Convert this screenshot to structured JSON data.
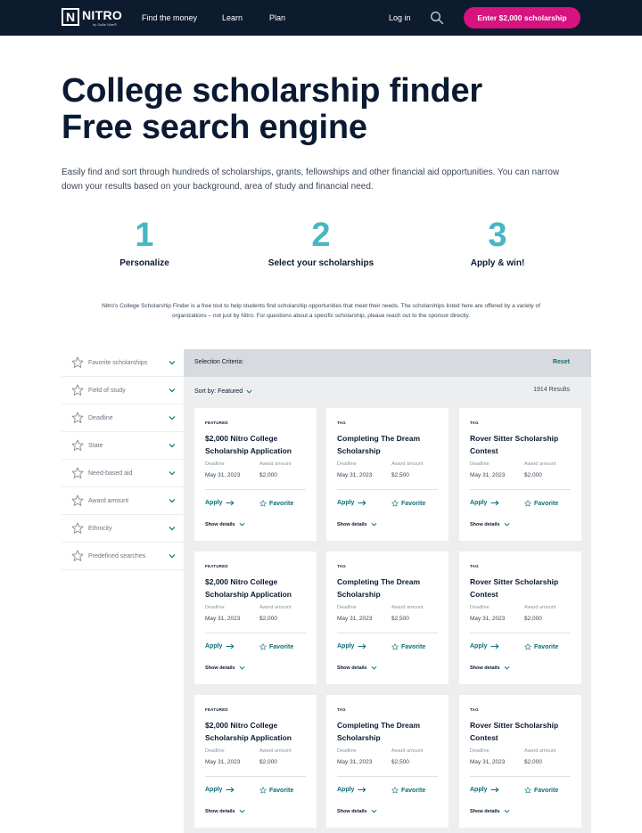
{
  "nav": {
    "logo_letter": "N",
    "logo_word": "NITRO",
    "logo_sub": "by Sallie Mae®",
    "links": [
      "Find the money",
      "Learn",
      "Plan"
    ],
    "login": "Log in",
    "search_icon": "search-icon",
    "cta": "Enter $2,000 scholarship",
    "cta_color": "#d6137f",
    "bg_color": "#0d1b2e"
  },
  "hero": {
    "title_line1": "College scholarship finder",
    "title_line2": "Free search engine",
    "description": "Easily find and sort through hundreds of scholarships, grants, fellowships and other financial aid opportunities. You can narrow down your results based on your background, area of study and financial need."
  },
  "steps": [
    {
      "number": "1",
      "label": "Personalize"
    },
    {
      "number": "2",
      "label": "Select your scholarships"
    },
    {
      "number": "3",
      "label": "Apply & win!"
    }
  ],
  "accent_color": "#46b7c4",
  "disclaimer": "Nitro’s College Scholarship Finder is a free tool to help students find scholarship opportunities that meet their needs. The scholarships listed here are offered by a variety of organizations – not just by Nitro. For questions about a specific scholarship, please reach out to the sponsor directly.",
  "filters": [
    "Favorite scholarships",
    "Field of study",
    "Deadline",
    "State",
    "Need-based aid",
    "Award amount",
    "Ethnicity",
    "Predefined searches"
  ],
  "panel": {
    "criteria_label": "Selection Criteria:",
    "reset": "Reset",
    "sort_label": "Sort by: Featured",
    "results": "1914 Results"
  },
  "card_labels": {
    "deadline": "Deadline",
    "award": "Award amount",
    "apply": "Apply",
    "favorite": "Favorite",
    "details": "Show details"
  },
  "cards": [
    {
      "tag": "FEATURED",
      "title": "$2,000 Nitro College Scholarship Application",
      "deadline": "May 31, 2023",
      "award": "$2,000"
    },
    {
      "tag": "TAG",
      "title": "Completing The Dream Scholarship",
      "deadline": "May 31, 2023",
      "award": "$2,500"
    },
    {
      "tag": "TAG",
      "title": "Rover Sitter Scholarship Contest",
      "deadline": "May 31, 2023",
      "award": "$2,000"
    },
    {
      "tag": "FEATURED",
      "title": "$2,000 Nitro College Scholarship Application",
      "deadline": "May 31, 2023",
      "award": "$2,000"
    },
    {
      "tag": "TAG",
      "title": "Completing The Dream Scholarship",
      "deadline": "May 31, 2023",
      "award": "$2,500"
    },
    {
      "tag": "TAG",
      "title": "Rover Sitter Scholarship Contest",
      "deadline": "May 31, 2023",
      "award": "$2,000"
    },
    {
      "tag": "FEATURED",
      "title": "$2,000 Nitro College Scholarship Application",
      "deadline": "May 31, 2023",
      "award": "$2,000"
    },
    {
      "tag": "TAG",
      "title": "Completing The Dream Scholarship",
      "deadline": "May 31, 2023",
      "award": "$2,500"
    },
    {
      "tag": "TAG",
      "title": "Rover Sitter Scholarship Contest",
      "deadline": "May 31, 2023",
      "award": "$2,000"
    }
  ]
}
